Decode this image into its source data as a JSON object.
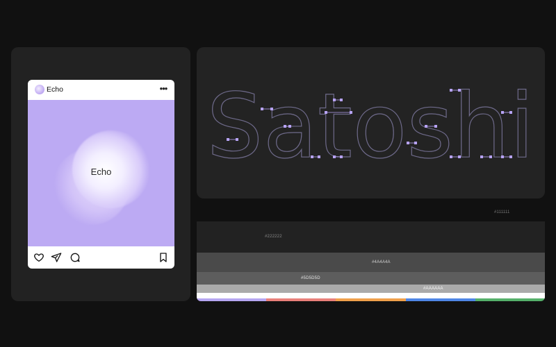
{
  "post": {
    "account_name": "Echo",
    "media_text": "Echo",
    "colors": {
      "media_bg": "#bcaaf3",
      "card_bg": "#ffffff"
    },
    "icons": [
      "heart-icon",
      "send-icon",
      "comment-icon",
      "bookmark-icon",
      "more-icon"
    ]
  },
  "typeface": {
    "word": "Satoshi",
    "colors": {
      "outline": "#6e6a8a",
      "anchor": "#b7a3f5"
    }
  },
  "palette": {
    "swatches": [
      {
        "hex": "#111111",
        "label": "#111111"
      },
      {
        "hex": "#222222",
        "label": "#222222"
      },
      {
        "hex": "#4A4A4A",
        "label": "#4A4A4A"
      },
      {
        "hex": "#5D5D5D",
        "label": "#5D5D5D"
      },
      {
        "hex": "#AAAAAA",
        "label": "#AAAAAA"
      },
      {
        "hex": "#FFFFFF",
        "label": ""
      }
    ],
    "accent_strip": [
      "#b6a6f2",
      "#e9807a",
      "#f0a04b",
      "#4f86e6",
      "#55b06a"
    ]
  }
}
